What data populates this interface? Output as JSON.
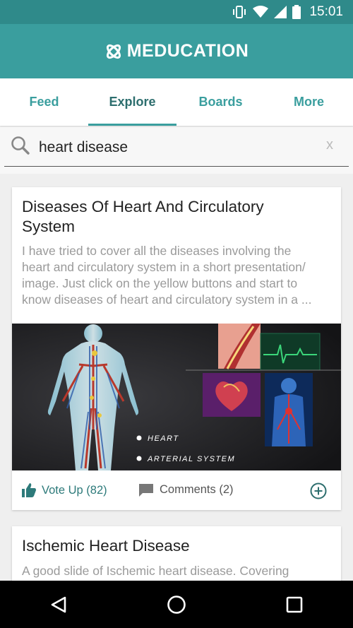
{
  "status_bar": {
    "time": "15:01"
  },
  "app": {
    "brand": "MEDUCATION"
  },
  "tabs": [
    {
      "label": "Feed",
      "active": false
    },
    {
      "label": "Explore",
      "active": true
    },
    {
      "label": "Boards",
      "active": false
    },
    {
      "label": "More",
      "active": false
    }
  ],
  "search": {
    "value": "heart disease",
    "clear_label": "x"
  },
  "results": [
    {
      "title_line1": "Diseases Of Heart And Circulatory",
      "title_line2": "System",
      "desc_line1": "I have tried to cover all the diseases involving the",
      "desc_line2": "heart and circulatory system in a short presentation/",
      "desc_line3": "image.  Just click on the yellow buttons and start to",
      "desc_line4": "know diseases of heart and circulatory system in a ...",
      "image_labels": {
        "label1": "HEART",
        "label2": "ARTERIAL SYSTEM"
      },
      "vote_label": "Vote Up (82)",
      "comments_label": "Comments (2)"
    },
    {
      "title_line1": "Ischemic Heart Disease",
      "desc_line1": "A good slide of Ischemic heart disease. Covering"
    }
  ],
  "colors": {
    "primary": "#3a9e9e",
    "status_bar": "#2f8a8a",
    "accent_text": "#2d7a7a"
  }
}
